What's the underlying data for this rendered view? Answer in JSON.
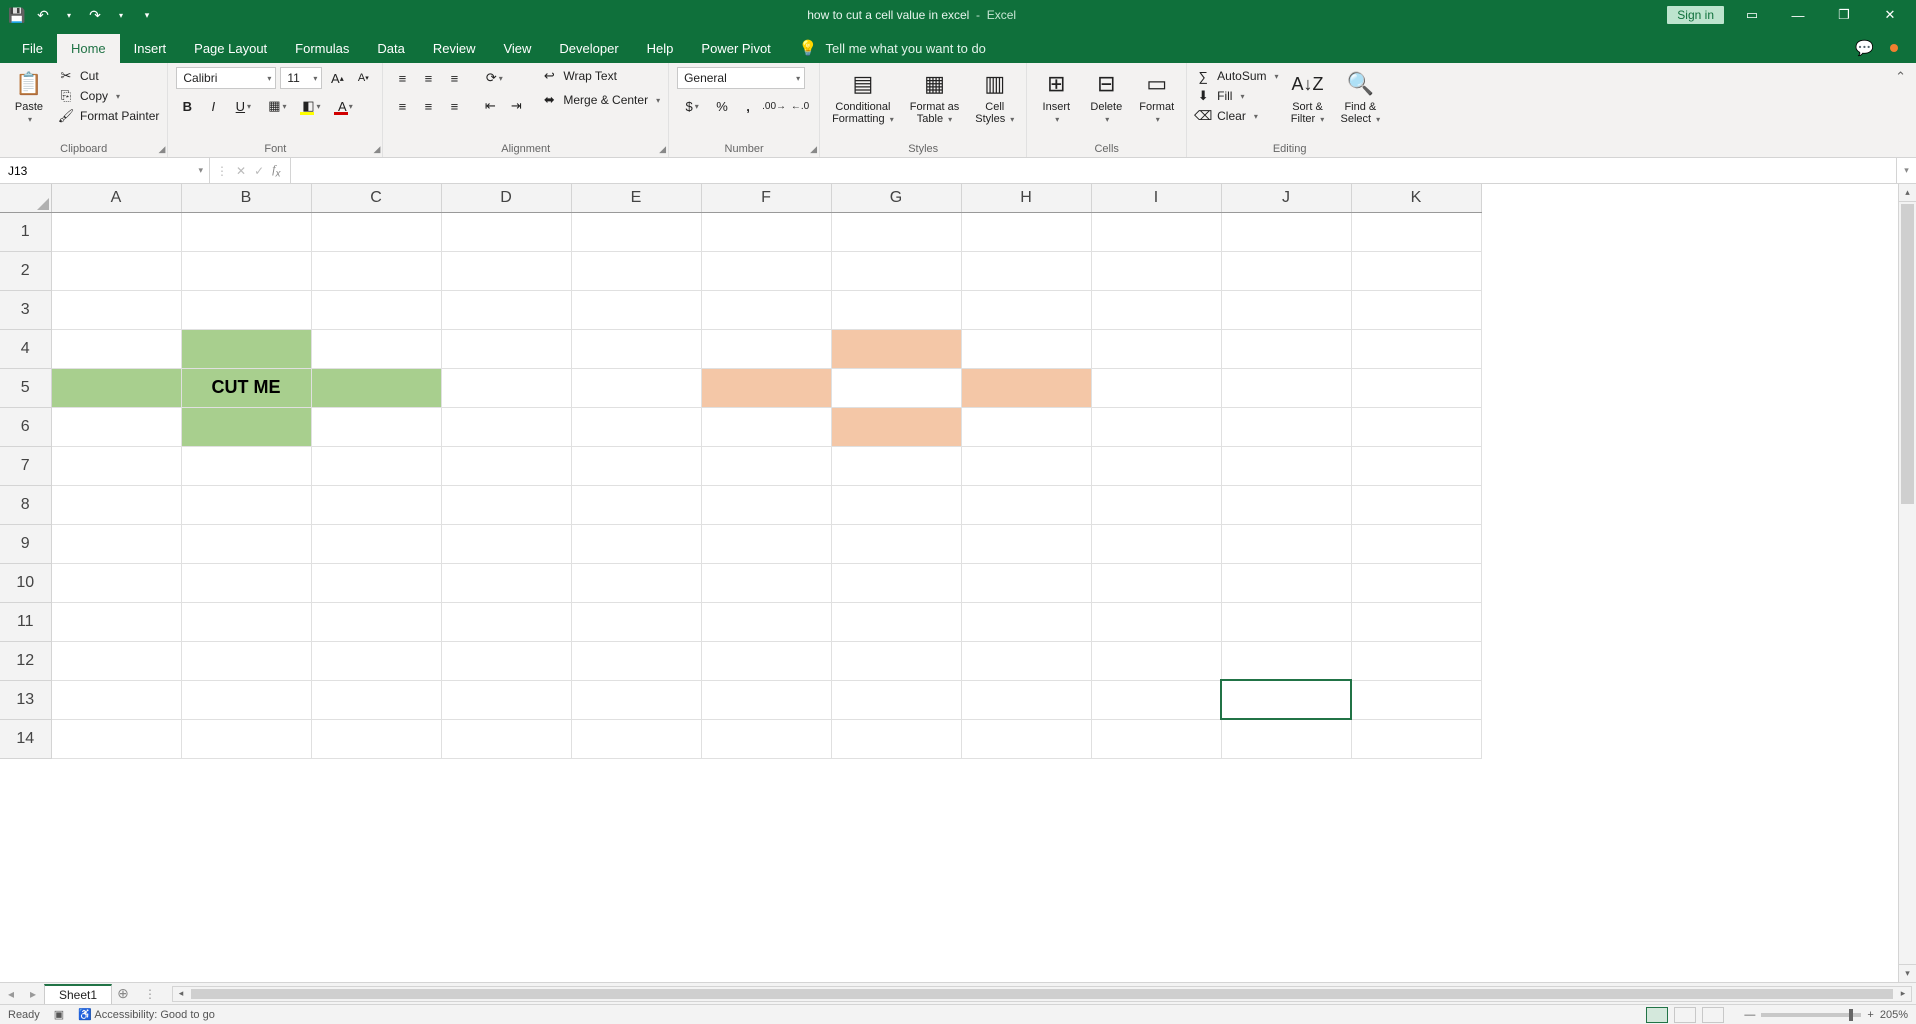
{
  "title": {
    "doc": "how to cut a cell value in excel",
    "app": "Excel"
  },
  "signin": "Sign in",
  "tabs": [
    "File",
    "Home",
    "Insert",
    "Page Layout",
    "Formulas",
    "Data",
    "Review",
    "View",
    "Developer",
    "Help",
    "Power Pivot"
  ],
  "tellme": "Tell me what you want to do",
  "ribbon": {
    "clipboard": {
      "paste": "Paste",
      "cut": "Cut",
      "copy": "Copy",
      "fp": "Format Painter",
      "label": "Clipboard"
    },
    "font": {
      "name": "Calibri",
      "size": "11",
      "label": "Font"
    },
    "align": {
      "wrap": "Wrap Text",
      "merge": "Merge & Center",
      "label": "Alignment"
    },
    "number": {
      "format": "General",
      "label": "Number"
    },
    "styles": {
      "cond1": "Conditional",
      "cond2": "Formatting",
      "ft1": "Format as",
      "ft2": "Table",
      "cs1": "Cell",
      "cs2": "Styles",
      "label": "Styles"
    },
    "cells": {
      "insert": "Insert",
      "delete": "Delete",
      "format": "Format",
      "label": "Cells"
    },
    "editing": {
      "autosum": "AutoSum",
      "fill": "Fill",
      "clear": "Clear",
      "sort1": "Sort &",
      "sort2": "Filter",
      "find1": "Find &",
      "find2": "Select",
      "label": "Editing"
    }
  },
  "name_box": "J13",
  "formula": "",
  "columns": [
    "A",
    "B",
    "C",
    "D",
    "E",
    "F",
    "G",
    "H",
    "I",
    "J",
    "K"
  ],
  "rows": [
    "1",
    "2",
    "3",
    "4",
    "5",
    "6",
    "7",
    "8",
    "9",
    "10",
    "11",
    "12",
    "13",
    "14"
  ],
  "cell_b5": "CUT ME",
  "sheet_tab": "Sheet1",
  "status": {
    "ready": "Ready",
    "acc": "Accessibility: Good to go",
    "zoom": "205%"
  }
}
